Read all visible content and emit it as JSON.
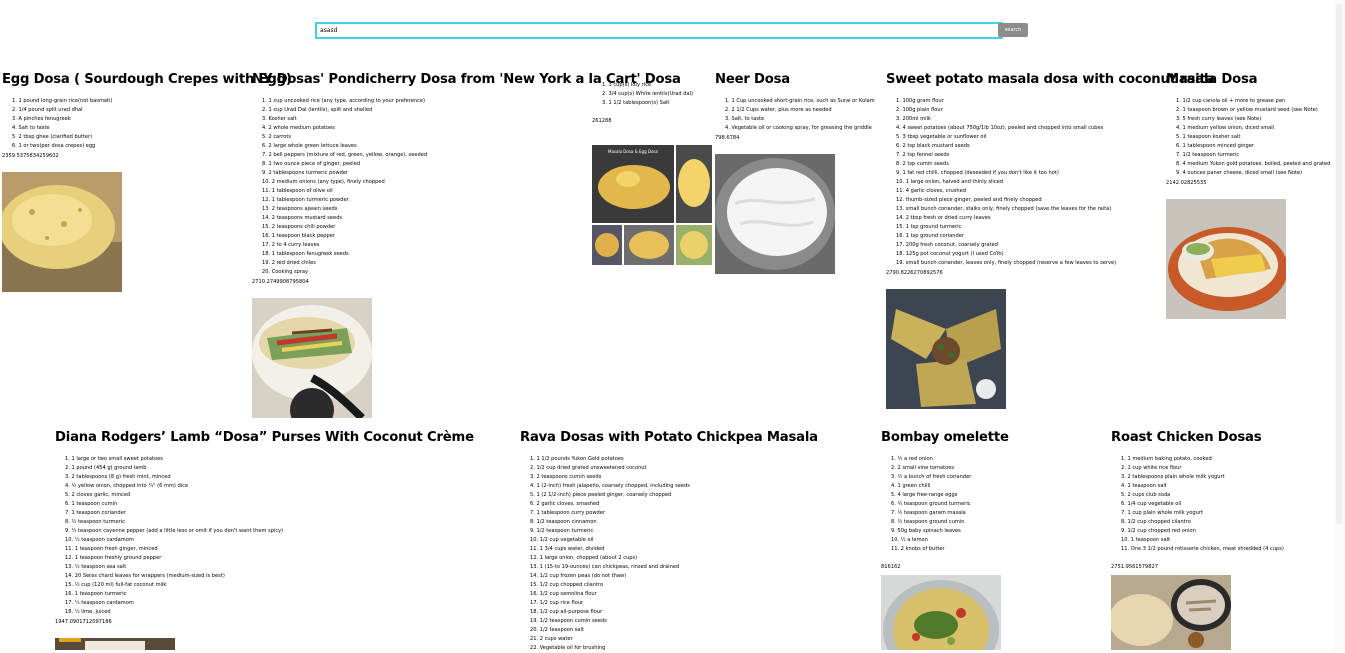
{
  "search": {
    "value": "asasd",
    "button_label": "search"
  },
  "recipes": [
    {
      "title": "Egg Dosa ( Sourdough Crepes with Egg)",
      "ingredients": [
        "1. 1 pound long-grain rice(not basmati)",
        "2. 1/4 pound split urad dhal",
        "3. A pinches fenugreek",
        "4. Salt to taste",
        "5. 2 tbsp ghee (clarified butter)",
        "6. 1 or two(per dosa crepes) egg"
      ],
      "number": "2359.5375834259602"
    },
    {
      "title": "NY Dosas' Pondicherry Dosa from 'New York a la Cart' Dosa",
      "ingredients": [
        "1. 1 cup uncooked rice (any type, according to your preference)",
        "2. 1 cup Urad Dal (lentils), split and shelled",
        "3. Kosher salt",
        "4. 2 whole medium potatoes",
        "5. 2 carrots",
        "6. 2 large whole green lettuce leaves",
        "7. 2 bell peppers (mixture of red, green, yellow, orange), seeded",
        "8. 1 two ounce piece of ginger, peeled",
        "9. 2 tablespoons turmeric powder",
        "10. 2 medium onions (any type), finely chopped",
        "11. 1 tablespoon of olive oil",
        "12. 1 tablespoon turmeric powder",
        "13. 2 teaspoons ajwain seeds",
        "14. 2 teaspoons mustard seeds",
        "15. 2 teaspoons chili powder",
        "16. 1 teaspoon black pepper",
        "17. 2 to 4 curry leaves",
        "18. 1 tablespoon fenugreek seeds",
        "19. 2 red dried chiles",
        "20. Cooking spray"
      ],
      "number": "2710.2749908795804"
    },
    {
      "title": "",
      "ingredients": [
        "1. 3 cup(s) Idly rice",
        "2. 3/4 cup(s) White lentils(Urad dal)",
        "3. 1 1/2 tablespoon(s) Salt"
      ],
      "number": "261288"
    },
    {
      "title": "Neer Dosa",
      "ingredients": [
        "1. 1 Cup uncooked short-grain rice, such as Surai or Kolam",
        "2. 2 1/2 Cups water, plus more as needed",
        "3. Salt, to taste",
        "4. Vegetable oil or cooking spray, for greasing the griddle"
      ],
      "number": "798.6784"
    },
    {
      "title": "Sweet potato masala dosa with coconut raita",
      "ingredients": [
        "1. 100g gram flour",
        "2. 100g plain flour",
        "3. 200ml milk",
        "4. 4 sweet potatoes (about 750g/1lb 10oz), peeled and chopped into small cubes",
        "5. 3 tbsp vegetable or sunflower oil",
        "6. 2 tsp black mustard seeds",
        "7. 2 tsp fennel seeds",
        "8. 2 tsp cumin seeds",
        "9. 1 fat red chilli, chopped (deseeded if you don't like it too hot)",
        "10. 1 large onion, halved and thinly sliced",
        "11. 4 garlic cloves, crushed",
        "12. thumb-sized piece ginger, peeled and finely chopped",
        "13. small bunch coriander, stalks only, finely chopped (save the leaves for the raita)",
        "14. 2 tbsp fresh or dried curry leaves",
        "15. 1 tsp ground turmeric",
        "16. 1 tsp ground coriander",
        "17. 200g fresh coconut, coarsely grated",
        "18. 125g pot coconut yogurt (I used CoYo)",
        "19. small bunch coriander, leaves only, finely chopped (reserve a few leaves to serve)"
      ],
      "number": "2790.8226270892576"
    },
    {
      "title": "Masala Dosa",
      "ingredients": [
        "1. 1/2 cup canola oil + more to grease pan",
        "2. 1 teaspoon brown or yellow mustard seed (see Note)",
        "3. 5 fresh curry leaves (see Note)",
        "4. 1 medium yellow onion, diced small",
        "5. 1 teaspoon kosher salt",
        "6. 1 tablespoon minced ginger",
        "7. 1/2 teaspoon turmeric",
        "8. 4 medium Yukon gold potatoes, boiled, peeled and grated",
        "9. 4 ounces paner cheese, diced small (see Note)"
      ],
      "number": "2142.02825535"
    },
    {
      "title": "Diana Rodgers’ Lamb “Dosa” Purses With Coconut Crème",
      "ingredients": [
        "1. 1 large or two small sweet potatoes",
        "2. 1 pound (454 g) ground lamb",
        "3. 2 tablespoons (8 g) fresh mint, minced",
        "4. ½ yellow onion, chopped into ¼\" (6 mm) dice",
        "5. 2 cloves garlic, minced",
        "6. 1 teaspoon cumin",
        "7. 1 teaspoon coriander",
        "8. ½ teaspoon turmeric",
        "9. ¼ teaspoon cayenne pepper (add a little less or omit if you don't want them spicy)",
        "10. ¼ teaspoon cardamom",
        "11. 1 teaspoon fresh ginger, minced",
        "12. 1 teaspoon freshly ground pepper",
        "13. ½ teaspoon sea salt",
        "14. 20 Swiss chard leaves for wrappers (medium-sized is best)",
        "15. ½ cup (120 ml) full-fat coconut milk",
        "16. 1 teaspoon turmeric",
        "17. ¼ teaspoon cardamom",
        "18. ¼ lime, juiced"
      ],
      "number": "1947.0901712097186"
    },
    {
      "title": "Rava Dosas with Potato Chickpea Masala",
      "ingredients": [
        "1. 1 1/2 pounds Yukon Gold potatoes",
        "2. 1/2 cup dried grated unsweetened coconut",
        "3. 2 teaspoons cumin seeds",
        "4. 1 (2-inch) fresh jalapeño, coarsely chopped, including seeds",
        "5. 1 (2 1/2-inch) piece peeled ginger, coarsely chopped",
        "6. 2 garlic cloves, smashed",
        "7. 1 tablespoon curry powder",
        "8. 1/2 teaspoon cinnamon",
        "9. 1/2 teaspoon turmeric",
        "10. 1/2 cup vegetable oil",
        "11. 1 3/4 cups water, divided",
        "12. 1 large onion, chopped (about 2 cups)",
        "13. 1 (15-to 19-ounces) can chickpeas, rinsed and drained",
        "14. 1/2 cup frozen peas (do not thaw)",
        "15. 1/2 cup chopped cilantro",
        "16. 1/2 cup semolina flour",
        "17. 1/2 cup rice flour",
        "18. 1/2 cup all-purpose flour",
        "19. 1/2 teaspoon cumin seeds",
        "20. 1/2 teaspoon salt",
        "21. 2 cups water",
        "22. Vegetable oil for brushing"
      ],
      "number": ""
    },
    {
      "title": "Bombay omelette",
      "ingredients": [
        "1. ½ a red onion",
        "2. 2 small vine tomatoes",
        "3. ½ a bunch of fresh coriander",
        "4. 1 green chilli",
        "5. 4 large free-range eggs",
        "6. ½ teaspoon ground turmeric",
        "7. ½ teaspoon garam masala",
        "8. ½ teaspoon ground cumin",
        "9. 50g baby spinach leaves",
        "10. ½ a lemon",
        "11. 2 knobs of butter"
      ],
      "number": "816162"
    },
    {
      "title": "Roast Chicken Dosas",
      "ingredients": [
        "1. 1 medium baking potato, cooked",
        "2. 1 cup white rice flour",
        "3. 2 tablespoons plain whole milk yogurt",
        "4. 1 teaspoon salt",
        "5. 2 cups club soda",
        "6. 1/4 cup vegetable oil",
        "7. 1 cup plain whole milk yogurt",
        "8. 1/2 cup chopped cilantro",
        "9. 1/2 cup chopped red onion",
        "10. 1 teaspoon salt",
        "11. One 3 1/2 pound rotisserie chicken, meat shredded (4 cups)"
      ],
      "number": "2751.9561579827"
    }
  ]
}
